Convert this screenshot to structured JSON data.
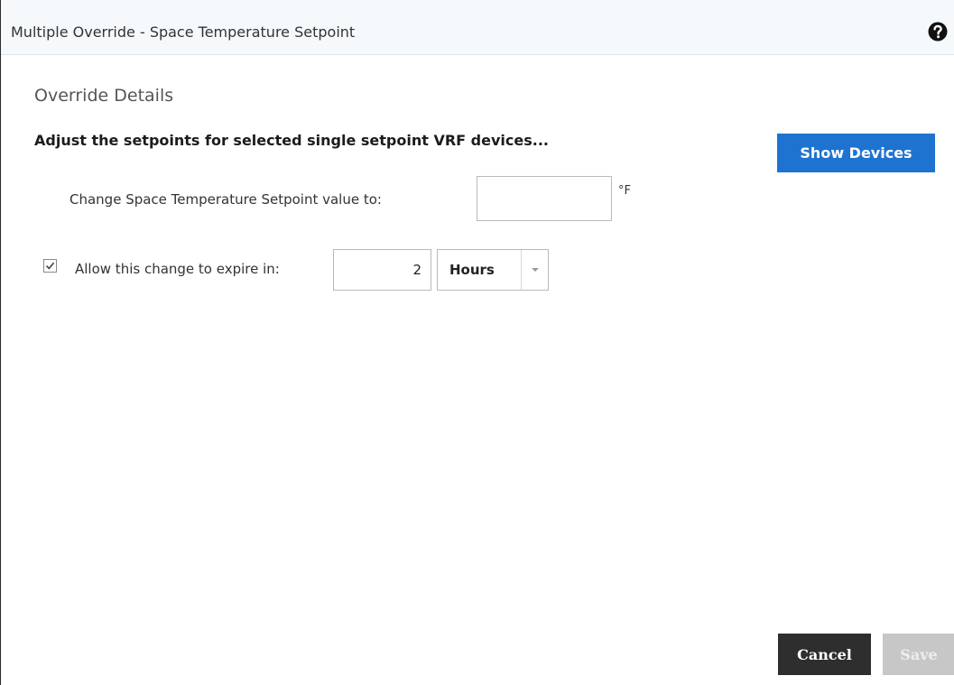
{
  "dialog": {
    "title": "Multiple Override - Space Temperature Setpoint",
    "help_icon": "question-circle-icon"
  },
  "override": {
    "section_title": "Override Details",
    "instruction": "Adjust the setpoints for selected single setpoint VRF devices...",
    "show_devices_label": "Show Devices",
    "setpoint_label": "Change Space Temperature Setpoint value to:",
    "setpoint_value": "",
    "unit": "°F",
    "expire_checked": true,
    "expire_label": "Allow this change to expire in:",
    "expire_value": "2",
    "expire_unit": "Hours"
  },
  "footer": {
    "cancel_label": "Cancel",
    "save_label": "Save"
  },
  "colors": {
    "primary_button": "#1f73d0",
    "cancel_button": "#2e2e2e",
    "disabled_button": "#c7c7c7",
    "titlebar_bg": "#f5f9fc"
  }
}
